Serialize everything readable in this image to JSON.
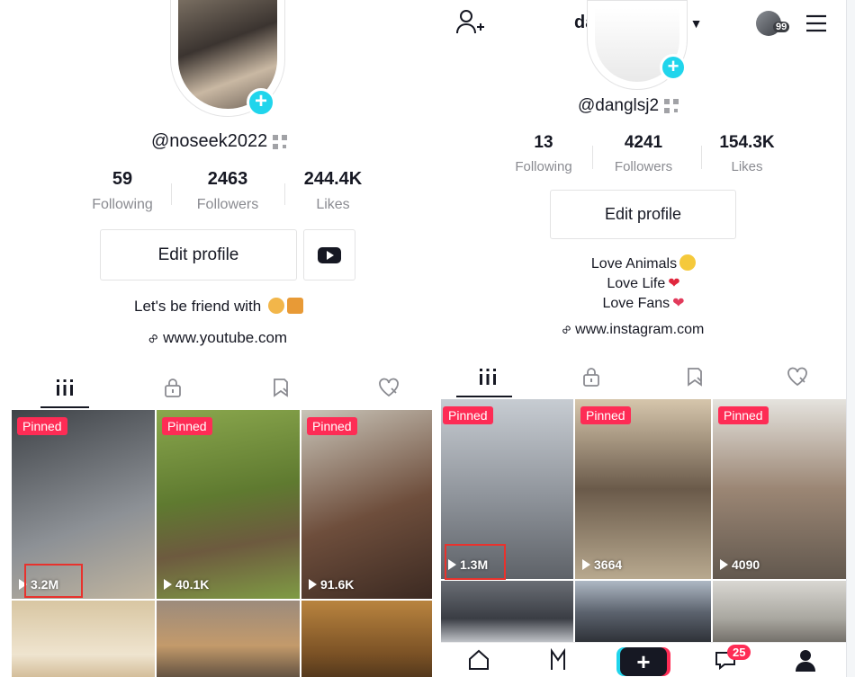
{
  "left_profile": {
    "username": "@noseek2022",
    "stats": [
      {
        "value": "59",
        "label": "Following"
      },
      {
        "value": "2463",
        "label": "Followers"
      },
      {
        "value": "244.4K",
        "label": "Likes"
      }
    ],
    "edit_button": "Edit profile",
    "bio": "Let's be friend with",
    "link": "www.youtube.com",
    "tabs": [
      "videos-grid-icon",
      "lock-icon",
      "bookmark-icon",
      "heart-icon"
    ],
    "videos": [
      {
        "pinned": "Pinned",
        "views": "3.2M",
        "color": "#6b6f74"
      },
      {
        "pinned": "Pinned",
        "views": "40.1K",
        "color": "#6f8f3a"
      },
      {
        "pinned": "Pinned",
        "views": "91.6K",
        "color": "#7d5d4a"
      },
      {
        "pinned": "",
        "views": "",
        "color": "#d9c9a8"
      },
      {
        "pinned": "",
        "views": "",
        "color": "#8a7060"
      },
      {
        "pinned": "",
        "views": "",
        "color": "#b07a3a"
      }
    ]
  },
  "right_profile": {
    "header_name": "darling_dang",
    "inbox_count_small": "99",
    "username": "@danglsj2",
    "stats": [
      {
        "value": "13",
        "label": "Following"
      },
      {
        "value": "4241",
        "label": "Followers"
      },
      {
        "value": "154.3K",
        "label": "Likes"
      }
    ],
    "edit_button": "Edit profile",
    "bio_lines": [
      "Love Animals",
      "Love Life",
      "Love Fans"
    ],
    "link": "www.instagram.com",
    "tabs": [
      "videos-grid-icon",
      "lock-icon",
      "bookmark-icon",
      "heart-icon"
    ],
    "videos": [
      {
        "pinned": "Pinned",
        "views": "1.3M",
        "color": "#8e939a"
      },
      {
        "pinned": "Pinned",
        "views": "3664",
        "color": "#6a5a4a"
      },
      {
        "pinned": "Pinned",
        "views": "4090",
        "color": "#7c6e62"
      },
      {
        "pinned": "",
        "views": "",
        "color": "#4a4e56"
      },
      {
        "pinned": "",
        "views": "",
        "color": "#5c636e"
      },
      {
        "pinned": "",
        "views": "",
        "color": "#a9a7a0"
      }
    ],
    "bottom_nav": {
      "inbox_badge": "25"
    }
  },
  "colors": {
    "accent_red": "#fe2c55",
    "accent_cyan": "#20d5ec",
    "highlight_box": "#e8322d"
  }
}
